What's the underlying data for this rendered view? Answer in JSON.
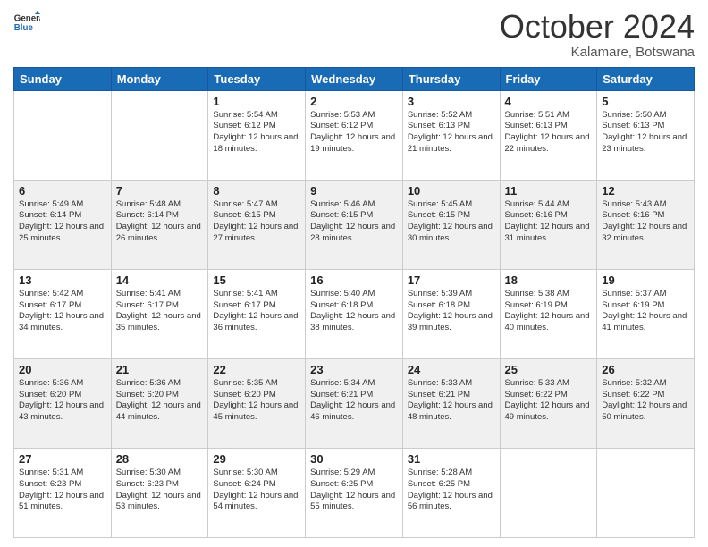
{
  "logo": {
    "line1": "General",
    "line2": "Blue"
  },
  "header": {
    "month": "October 2024",
    "location": "Kalamare, Botswana"
  },
  "weekdays": [
    "Sunday",
    "Monday",
    "Tuesday",
    "Wednesday",
    "Thursday",
    "Friday",
    "Saturday"
  ],
  "weeks": [
    [
      {
        "day": "",
        "info": ""
      },
      {
        "day": "",
        "info": ""
      },
      {
        "day": "1",
        "info": "Sunrise: 5:54 AM\nSunset: 6:12 PM\nDaylight: 12 hours and 18 minutes."
      },
      {
        "day": "2",
        "info": "Sunrise: 5:53 AM\nSunset: 6:12 PM\nDaylight: 12 hours and 19 minutes."
      },
      {
        "day": "3",
        "info": "Sunrise: 5:52 AM\nSunset: 6:13 PM\nDaylight: 12 hours and 21 minutes."
      },
      {
        "day": "4",
        "info": "Sunrise: 5:51 AM\nSunset: 6:13 PM\nDaylight: 12 hours and 22 minutes."
      },
      {
        "day": "5",
        "info": "Sunrise: 5:50 AM\nSunset: 6:13 PM\nDaylight: 12 hours and 23 minutes."
      }
    ],
    [
      {
        "day": "6",
        "info": "Sunrise: 5:49 AM\nSunset: 6:14 PM\nDaylight: 12 hours and 25 minutes."
      },
      {
        "day": "7",
        "info": "Sunrise: 5:48 AM\nSunset: 6:14 PM\nDaylight: 12 hours and 26 minutes."
      },
      {
        "day": "8",
        "info": "Sunrise: 5:47 AM\nSunset: 6:15 PM\nDaylight: 12 hours and 27 minutes."
      },
      {
        "day": "9",
        "info": "Sunrise: 5:46 AM\nSunset: 6:15 PM\nDaylight: 12 hours and 28 minutes."
      },
      {
        "day": "10",
        "info": "Sunrise: 5:45 AM\nSunset: 6:15 PM\nDaylight: 12 hours and 30 minutes."
      },
      {
        "day": "11",
        "info": "Sunrise: 5:44 AM\nSunset: 6:16 PM\nDaylight: 12 hours and 31 minutes."
      },
      {
        "day": "12",
        "info": "Sunrise: 5:43 AM\nSunset: 6:16 PM\nDaylight: 12 hours and 32 minutes."
      }
    ],
    [
      {
        "day": "13",
        "info": "Sunrise: 5:42 AM\nSunset: 6:17 PM\nDaylight: 12 hours and 34 minutes."
      },
      {
        "day": "14",
        "info": "Sunrise: 5:41 AM\nSunset: 6:17 PM\nDaylight: 12 hours and 35 minutes."
      },
      {
        "day": "15",
        "info": "Sunrise: 5:41 AM\nSunset: 6:17 PM\nDaylight: 12 hours and 36 minutes."
      },
      {
        "day": "16",
        "info": "Sunrise: 5:40 AM\nSunset: 6:18 PM\nDaylight: 12 hours and 38 minutes."
      },
      {
        "day": "17",
        "info": "Sunrise: 5:39 AM\nSunset: 6:18 PM\nDaylight: 12 hours and 39 minutes."
      },
      {
        "day": "18",
        "info": "Sunrise: 5:38 AM\nSunset: 6:19 PM\nDaylight: 12 hours and 40 minutes."
      },
      {
        "day": "19",
        "info": "Sunrise: 5:37 AM\nSunset: 6:19 PM\nDaylight: 12 hours and 41 minutes."
      }
    ],
    [
      {
        "day": "20",
        "info": "Sunrise: 5:36 AM\nSunset: 6:20 PM\nDaylight: 12 hours and 43 minutes."
      },
      {
        "day": "21",
        "info": "Sunrise: 5:36 AM\nSunset: 6:20 PM\nDaylight: 12 hours and 44 minutes."
      },
      {
        "day": "22",
        "info": "Sunrise: 5:35 AM\nSunset: 6:20 PM\nDaylight: 12 hours and 45 minutes."
      },
      {
        "day": "23",
        "info": "Sunrise: 5:34 AM\nSunset: 6:21 PM\nDaylight: 12 hours and 46 minutes."
      },
      {
        "day": "24",
        "info": "Sunrise: 5:33 AM\nSunset: 6:21 PM\nDaylight: 12 hours and 48 minutes."
      },
      {
        "day": "25",
        "info": "Sunrise: 5:33 AM\nSunset: 6:22 PM\nDaylight: 12 hours and 49 minutes."
      },
      {
        "day": "26",
        "info": "Sunrise: 5:32 AM\nSunset: 6:22 PM\nDaylight: 12 hours and 50 minutes."
      }
    ],
    [
      {
        "day": "27",
        "info": "Sunrise: 5:31 AM\nSunset: 6:23 PM\nDaylight: 12 hours and 51 minutes."
      },
      {
        "day": "28",
        "info": "Sunrise: 5:30 AM\nSunset: 6:23 PM\nDaylight: 12 hours and 53 minutes."
      },
      {
        "day": "29",
        "info": "Sunrise: 5:30 AM\nSunset: 6:24 PM\nDaylight: 12 hours and 54 minutes."
      },
      {
        "day": "30",
        "info": "Sunrise: 5:29 AM\nSunset: 6:25 PM\nDaylight: 12 hours and 55 minutes."
      },
      {
        "day": "31",
        "info": "Sunrise: 5:28 AM\nSunset: 6:25 PM\nDaylight: 12 hours and 56 minutes."
      },
      {
        "day": "",
        "info": ""
      },
      {
        "day": "",
        "info": ""
      }
    ]
  ]
}
